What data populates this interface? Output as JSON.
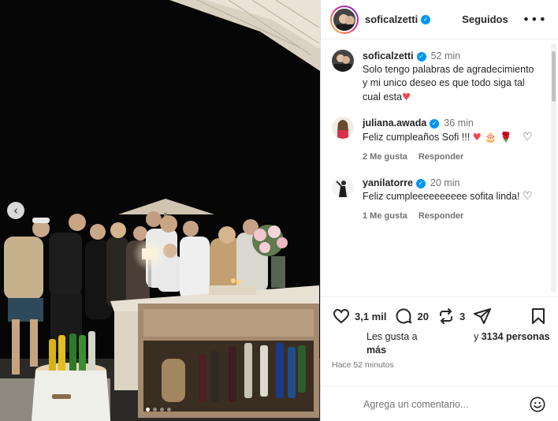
{
  "post": {
    "author": "soficalzetti",
    "follow_label": "Seguidos",
    "more_label": "•••",
    "caption": {
      "user": "soficalzetti",
      "time": "52 min",
      "text": "Solo tengo palabras de agradecimiento y mi unico deseo es que todo siga tal cual esta",
      "emoji": "♥"
    },
    "comments": [
      {
        "user": "juliana.awada",
        "time": "36 min",
        "text": "Feliz cumpleaños Sofi !!! ",
        "emoji": "♥ 🎂 🌹",
        "likes": "2 Me gusta",
        "reply": "Responder"
      },
      {
        "user": "yanilatorre",
        "time": "20 min",
        "text": "Feliz cumpleeeeeeeeee sofita linda!",
        "emoji": "",
        "likes": "1 Me gusta",
        "reply": "Responder"
      }
    ],
    "stats": {
      "likes": "3,1 mil",
      "comments": "20",
      "reposts": "3"
    },
    "likes_text": {
      "prefix": "Les gusta a",
      "who": "más",
      "middle": "y",
      "others": "3134 personas"
    },
    "time_ago": "Hace 52 minutos",
    "add_comment_placeholder": "Agrega un comentario...",
    "carousel": {
      "total": 4,
      "active": 1
    }
  },
  "colors": {
    "accent": "#0095f6",
    "heart": "#ed4956",
    "muted": "#737373"
  },
  "icons": [
    "verified-icon",
    "heart-icon",
    "comment-icon",
    "repost-icon",
    "share-icon",
    "bookmark-icon",
    "emoji-icon",
    "chevron-left-icon"
  ]
}
